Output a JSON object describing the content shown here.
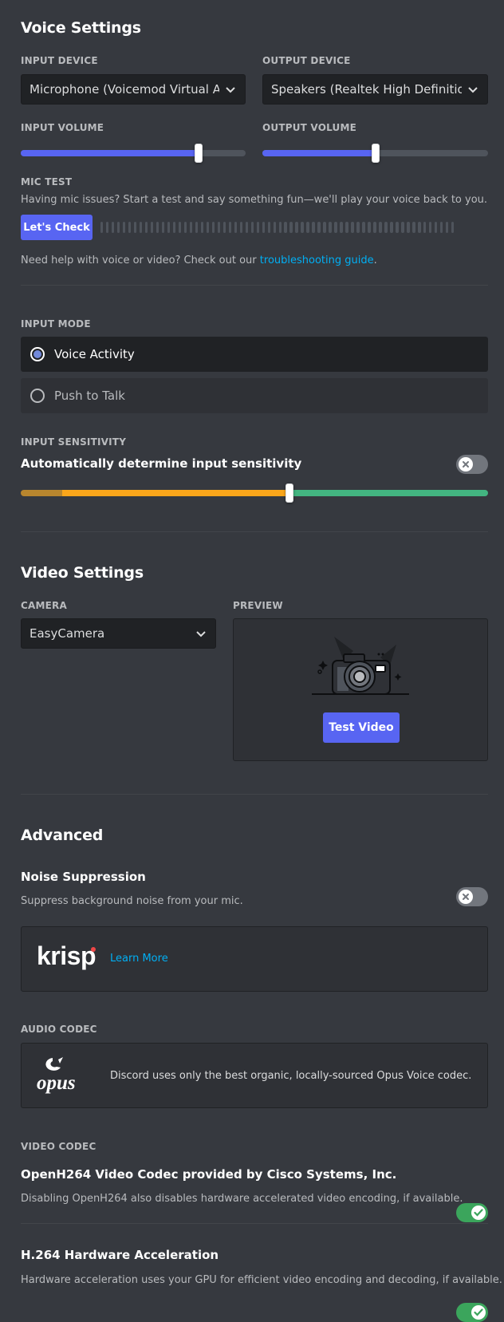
{
  "voice": {
    "heading": "Voice Settings",
    "input_device_label": "INPUT DEVICE",
    "input_device_value": "Microphone (Voicemod Virtual Audio Device)",
    "output_device_label": "OUTPUT DEVICE",
    "output_device_value": "Speakers (Realtek High Definition Audio)",
    "input_volume_label": "INPUT VOLUME",
    "input_volume": 0.79,
    "output_volume_label": "OUTPUT VOLUME",
    "output_volume": 0.5,
    "mic_test_label": "MIC TEST",
    "mic_test_desc": "Having mic issues? Start a test and say something fun—we'll play your voice back to you.",
    "mic_test_button": "Let's Check",
    "help_prefix": "Need help with voice or video? Check out our",
    "help_link": "troubleshooting guide",
    "help_suffix": ".",
    "input_mode_label": "INPUT MODE",
    "mode_voice_activity": "Voice Activity",
    "mode_push_to_talk": "Push to Talk",
    "selected_mode": "Voice Activity",
    "sensitivity_label": "INPUT SENSITIVITY",
    "auto_sensitivity_label": "Automatically determine input sensitivity",
    "auto_sensitivity_enabled": false,
    "sensitivity_level": 0.575
  },
  "video": {
    "heading": "Video Settings",
    "camera_label": "CAMERA",
    "camera_value": "EasyCamera",
    "preview_label": "PREVIEW",
    "test_video_button": "Test Video"
  },
  "advanced": {
    "heading": "Advanced",
    "noise_suppression_title": "Noise Suppression",
    "noise_suppression_enabled": false,
    "noise_suppression_desc": "Suppress background noise from your mic.",
    "krisp_logo": "krisp",
    "krisp_learn_more": "Learn More",
    "audio_codec_label": "AUDIO CODEC",
    "opus_logo": "opus",
    "opus_desc": "Discord uses only the best organic, locally-sourced Opus Voice codec.",
    "video_codec_label": "VIDEO CODEC",
    "openh264_title": "OpenH264 Video Codec provided by Cisco Systems, Inc.",
    "openh264_enabled": true,
    "openh264_desc": "Disabling OpenH264 also disables hardware accelerated video encoding, if available.",
    "h264_title": "H.264 Hardware Acceleration",
    "h264_enabled": true,
    "h264_desc": "Hardware acceleration uses your GPU for efficient video encoding and decoding, if available."
  },
  "colors": {
    "background": "#36393f",
    "accent": "#5865f2",
    "toggle_on": "#3ba55c",
    "toggle_off": "#72767d",
    "sensitivity_low": "#faa61a",
    "sensitivity_high": "#43b581",
    "link": "#00aff4"
  },
  "icons": {
    "dropdown": "chevron-down-icon",
    "toggle_off": "x-icon",
    "toggle_on": "check-icon",
    "preview": "camera-illustration"
  }
}
